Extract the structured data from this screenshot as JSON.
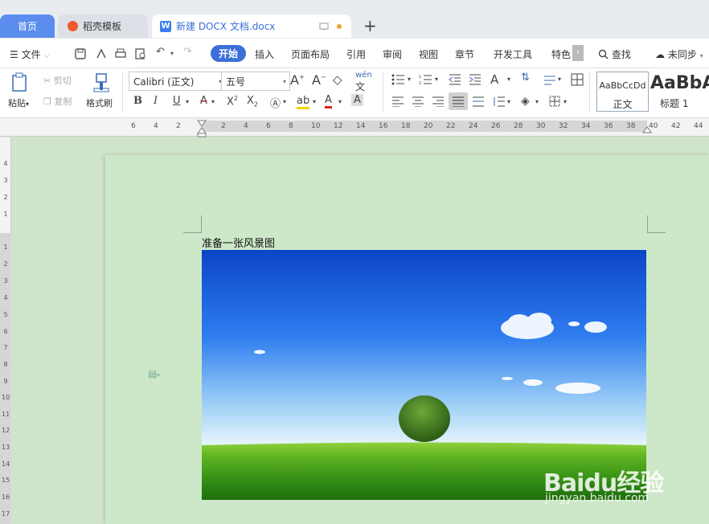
{
  "tabs": {
    "home": "首页",
    "template": "稻壳模板",
    "document": "新建 DOCX 文档.docx",
    "doc_icon_letter": "W",
    "new_tab": "+"
  },
  "menu": {
    "file": "文件",
    "items": [
      "开始",
      "插入",
      "页面布局",
      "引用",
      "审阅",
      "视图",
      "章节",
      "开发工具",
      "特色"
    ],
    "search": "查找",
    "sync": "未同步"
  },
  "toolbar": {
    "paste": "粘贴",
    "cut": "剪切",
    "copy": "复制",
    "format_painter": "格式刷",
    "font_name": "Calibri (正文)",
    "font_size": "五号",
    "wen": "wén",
    "styles": {
      "normal_preview": "AaBbCcDd",
      "normal_label": "正文",
      "heading_preview": "AaBbA",
      "heading_label": "标题 1"
    }
  },
  "ruler": {
    "h_ticks": [
      "6",
      "4",
      "2",
      "2",
      "4",
      "6",
      "8",
      "10",
      "12",
      "14",
      "16",
      "18",
      "20",
      "22",
      "24",
      "26",
      "28",
      "30",
      "32",
      "34",
      "36",
      "38",
      "40",
      "42",
      "44"
    ],
    "v_ticks": [
      "4",
      "3",
      "2",
      "1",
      "1",
      "2",
      "3",
      "4",
      "5",
      "6",
      "7",
      "8",
      "9",
      "10",
      "11",
      "12",
      "13",
      "14",
      "15",
      "16",
      "17"
    ]
  },
  "document": {
    "paragraph": "准备一张风景图"
  },
  "watermark": {
    "brand": "Baidu经验",
    "url": "jingyan.baidu.com"
  },
  "colors": {
    "accent": "#3b6fd9",
    "page": "#cce8c8"
  }
}
